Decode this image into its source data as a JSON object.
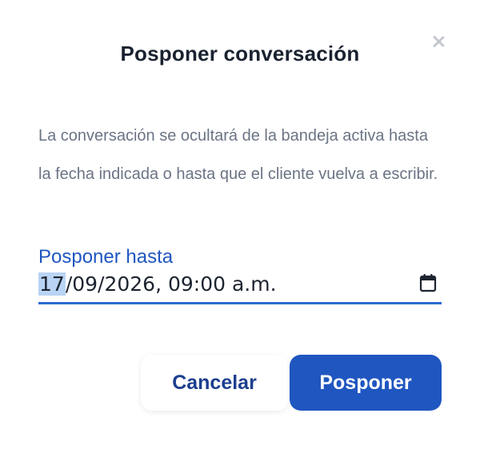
{
  "dialog": {
    "title": "Posponer conversación",
    "description": "La conversación se ocultará de la bandeja activa hasta la fecha indicada o hasta que el cliente vuelva a escribir.",
    "field": {
      "label": "Posponer hasta",
      "day": "17",
      "value_rest": "/09/2026, 09:00 a.m."
    },
    "buttons": {
      "cancel": "Cancelar",
      "confirm": "Posponer"
    }
  },
  "colors": {
    "primary": "#1f56c0",
    "title": "#1a2230",
    "body_text": "#6b7485",
    "close_icon": "#c4c8cf",
    "selection": "#b9d4f4"
  },
  "icons": {
    "close": "close-icon",
    "calendar": "calendar-icon"
  }
}
